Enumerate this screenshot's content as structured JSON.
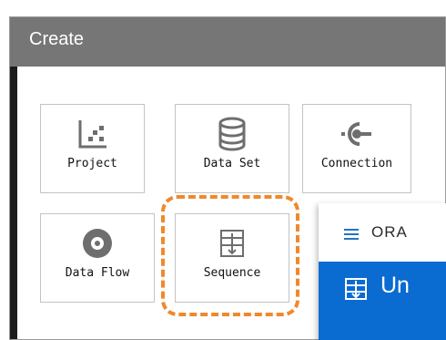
{
  "dialog": {
    "title": "Create",
    "tiles": [
      {
        "label": "Project",
        "icon": "project-scatter-icon"
      },
      {
        "label": "Data Set",
        "icon": "database-icon"
      },
      {
        "label": "Connection",
        "icon": "connection-plug-icon"
      },
      {
        "label": "Data Flow",
        "icon": "data-flow-icon"
      },
      {
        "label": "Sequence",
        "icon": "sequence-icon"
      }
    ]
  },
  "overlay": {
    "brand": "ORA",
    "panel_text": "Un"
  },
  "colors": {
    "titlebar": "#767676",
    "highlight": "#f0892b",
    "accent_blue": "#0a6bd1",
    "icon_gray": "#6e6e6e"
  }
}
